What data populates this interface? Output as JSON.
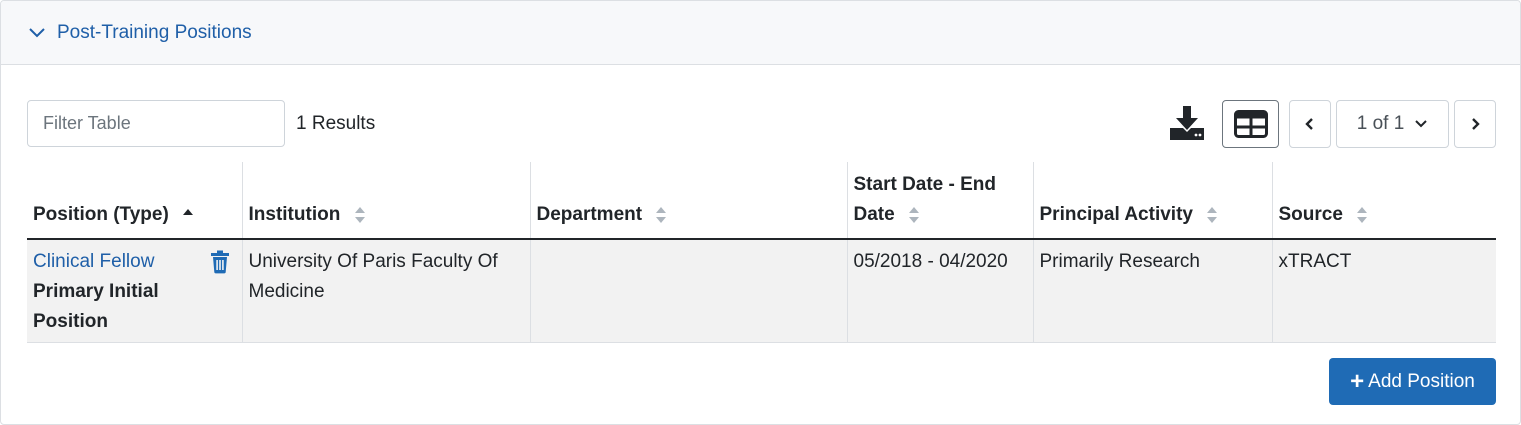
{
  "section": {
    "title": "Post-Training Positions"
  },
  "toolbar": {
    "filter_placeholder": "Filter Table",
    "results_text": "1 Results",
    "page_label": "1 of 1"
  },
  "table": {
    "columns": [
      {
        "label": "Position (Type)",
        "sort": "asc"
      },
      {
        "label": "Institution",
        "sort": "none"
      },
      {
        "label": "Department",
        "sort": "none"
      },
      {
        "label": "Start Date - End Date",
        "sort": "none"
      },
      {
        "label": "Principal Activity",
        "sort": "none"
      },
      {
        "label": "Source",
        "sort": "none"
      }
    ],
    "rows": [
      {
        "position": "Clinical Fellow",
        "type": "Primary Initial Position",
        "institution": "University Of Paris Faculty Of Medicine",
        "department": "",
        "dates": "05/2018 - 04/2020",
        "activity": "Primarily Research",
        "source": "xTRACT"
      }
    ]
  },
  "actions": {
    "add_label": "Add Position"
  },
  "icons": {
    "collapse": "chevron-down-icon",
    "download": "download-icon",
    "grid": "table-grid-icon",
    "prev": "chevron-left-icon",
    "next": "chevron-right-icon",
    "page_dropdown": "chevron-down-icon",
    "delete": "trash-icon",
    "sort": "sort-icon",
    "add": "plus-icon"
  },
  "colors": {
    "link": "#1f5fa8",
    "primary_button": "#1f6bb5",
    "row_background": "#f2f2f2"
  }
}
